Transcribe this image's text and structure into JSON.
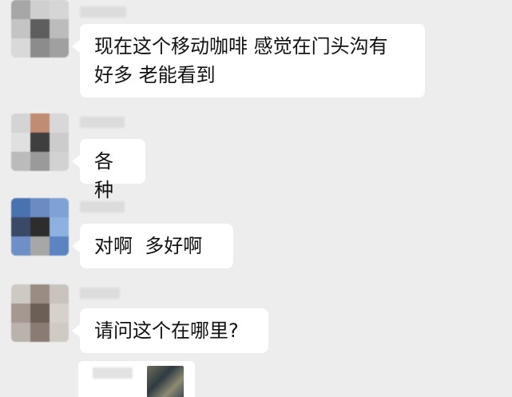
{
  "messages": [
    {
      "text": "现在这个移动咖啡 感觉在门头沟有\n好多 老能看到"
    },
    {
      "text": "各种"
    },
    {
      "text": "对啊  多好啊"
    },
    {
      "text": "请问这个在哪里?"
    }
  ],
  "colors": {
    "background": "#ededed",
    "bubble": "#ffffff",
    "text": "#111111"
  }
}
